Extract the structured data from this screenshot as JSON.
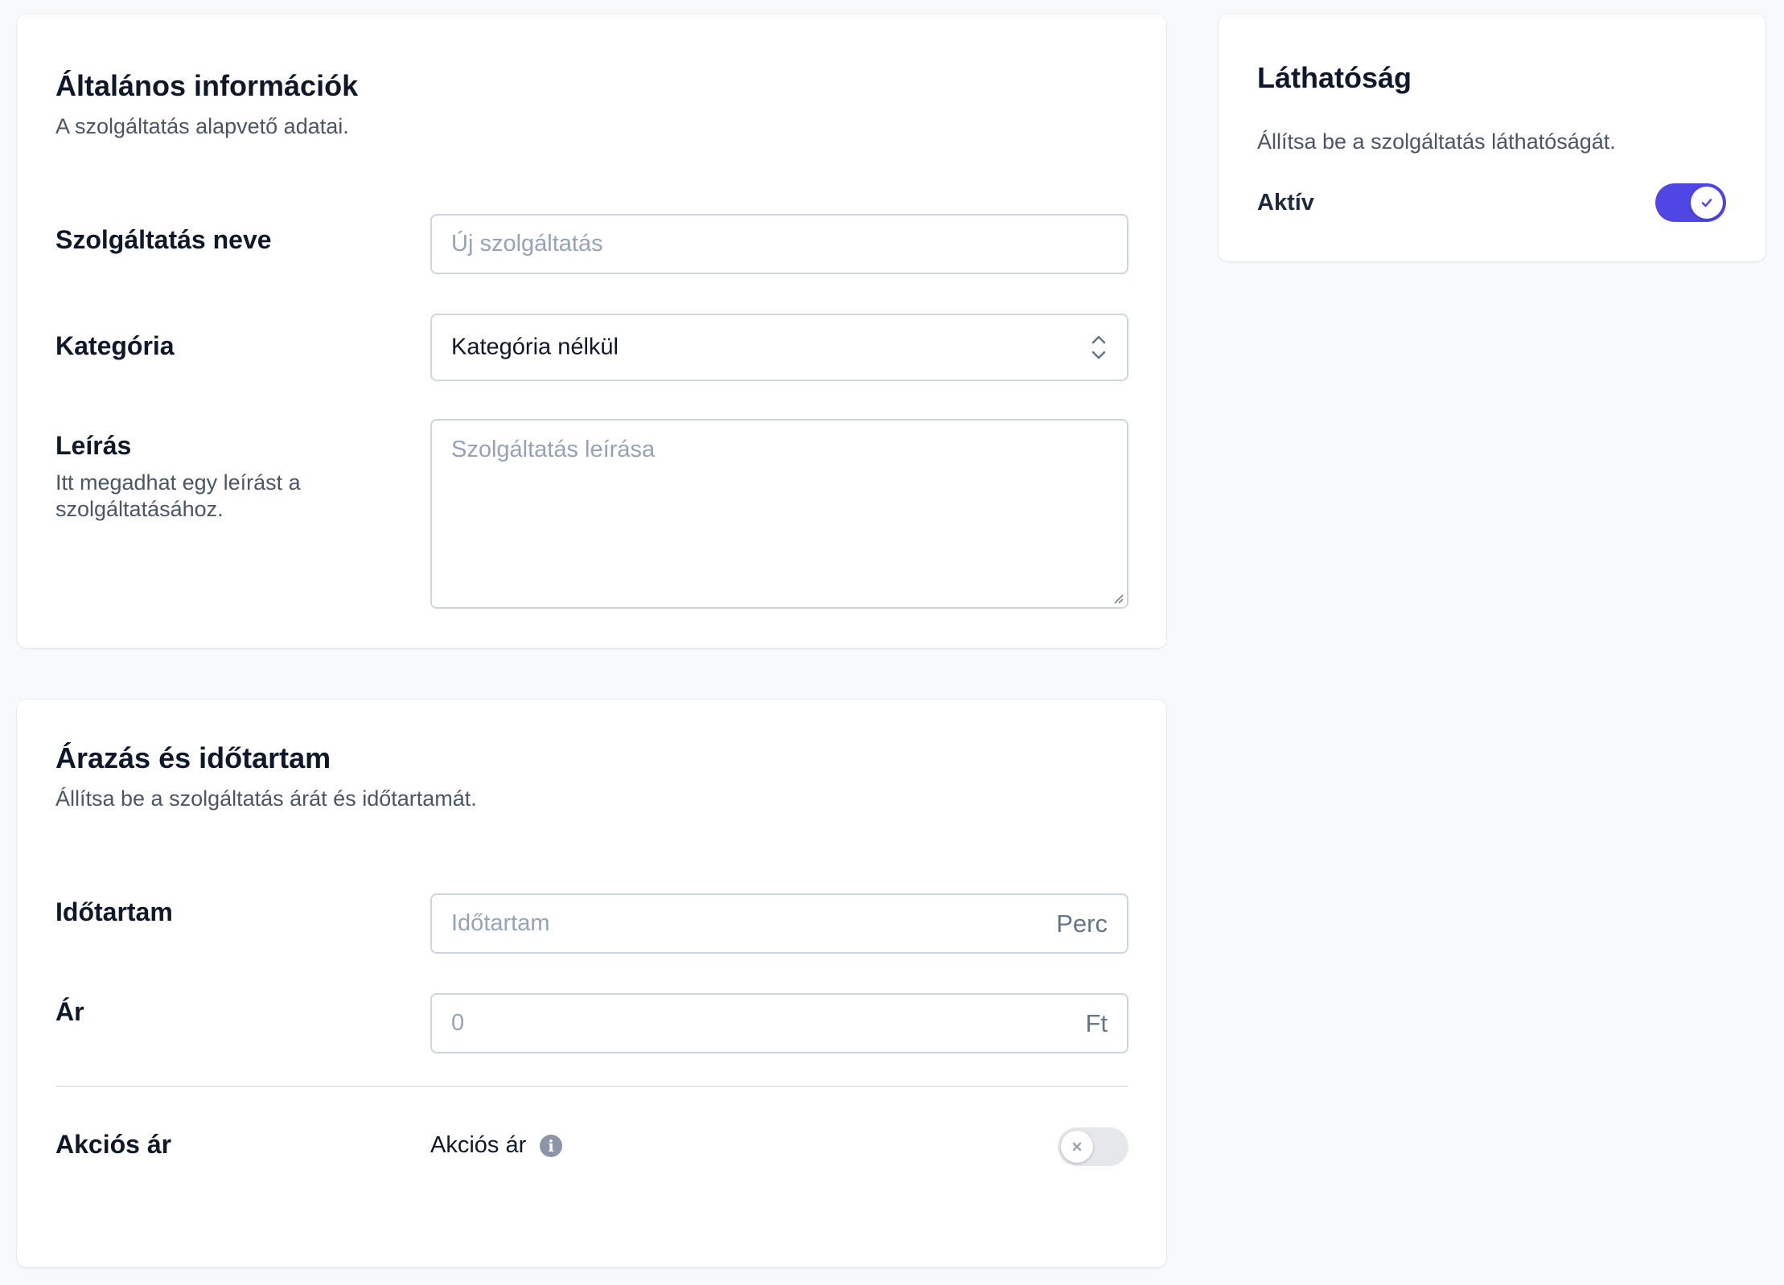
{
  "general": {
    "title": "Általános információk",
    "subtitle": "A szolgáltatás alapvető adatai.",
    "name_label": "Szolgáltatás neve",
    "name_placeholder": "Új szolgáltatás",
    "name_value": "",
    "category_label": "Kategória",
    "category_value": "Kategória nélkül",
    "description_label": "Leírás",
    "description_help": "Itt megadhat egy leírást a szolgáltatásához.",
    "description_placeholder": "Szolgáltatás leírása",
    "description_value": ""
  },
  "pricing": {
    "title": "Árazás és időtartam",
    "subtitle": "Állítsa be a szolgáltatás árát és időtartamát.",
    "duration_label": "Időtartam",
    "duration_placeholder": "Időtartam",
    "duration_suffix": "Perc",
    "price_label": "Ár",
    "price_placeholder": "0",
    "price_suffix": "Ft",
    "sale_label": "Akciós ár",
    "sale_inline_label": "Akciós ár",
    "sale_enabled": false
  },
  "visibility": {
    "title": "Láthatóság",
    "subtitle": "Állítsa be a szolgáltatás láthatóságát.",
    "active_label": "Aktív",
    "active_enabled": true
  },
  "colors": {
    "accent": "#4f46e5",
    "toggle_off": "#e5e7eb",
    "background": "#f8f9fb"
  },
  "icons": {
    "select": "chevron-up-down-icon",
    "info": "info-icon",
    "toggle_on": "check-icon",
    "toggle_off": "x-icon"
  }
}
